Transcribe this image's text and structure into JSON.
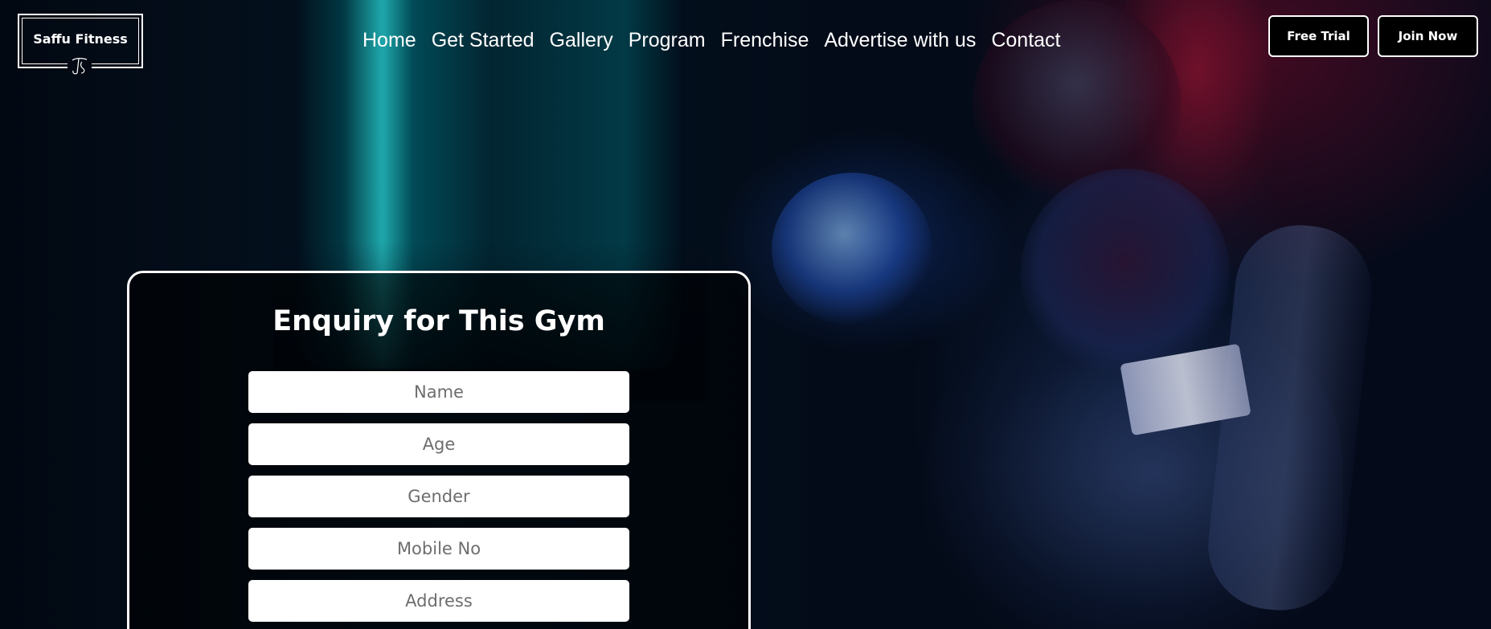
{
  "header": {
    "logo_text": "Saffu Fitness",
    "logo_mark": "SF",
    "nav": {
      "home": "Home",
      "get_started": "Get Started",
      "gallery": "Gallery",
      "program": "Program",
      "franchise": "Frenchise",
      "advertise": "Advertise with us",
      "contact": "Contact"
    },
    "free_trial": "Free Trial",
    "join_now": "Join Now"
  },
  "hero": {
    "background": "boxer-with-punching-bag-photo",
    "colors": {
      "accent_teal": "#28dcdc",
      "accent_red": "#96143a",
      "background": "#02060f"
    }
  },
  "enquiry": {
    "title": "Enquiry for This Gym",
    "fields": {
      "name": "Name",
      "age": "Age",
      "gender": "Gender",
      "mobile": "Mobile No",
      "address": "Address"
    }
  }
}
